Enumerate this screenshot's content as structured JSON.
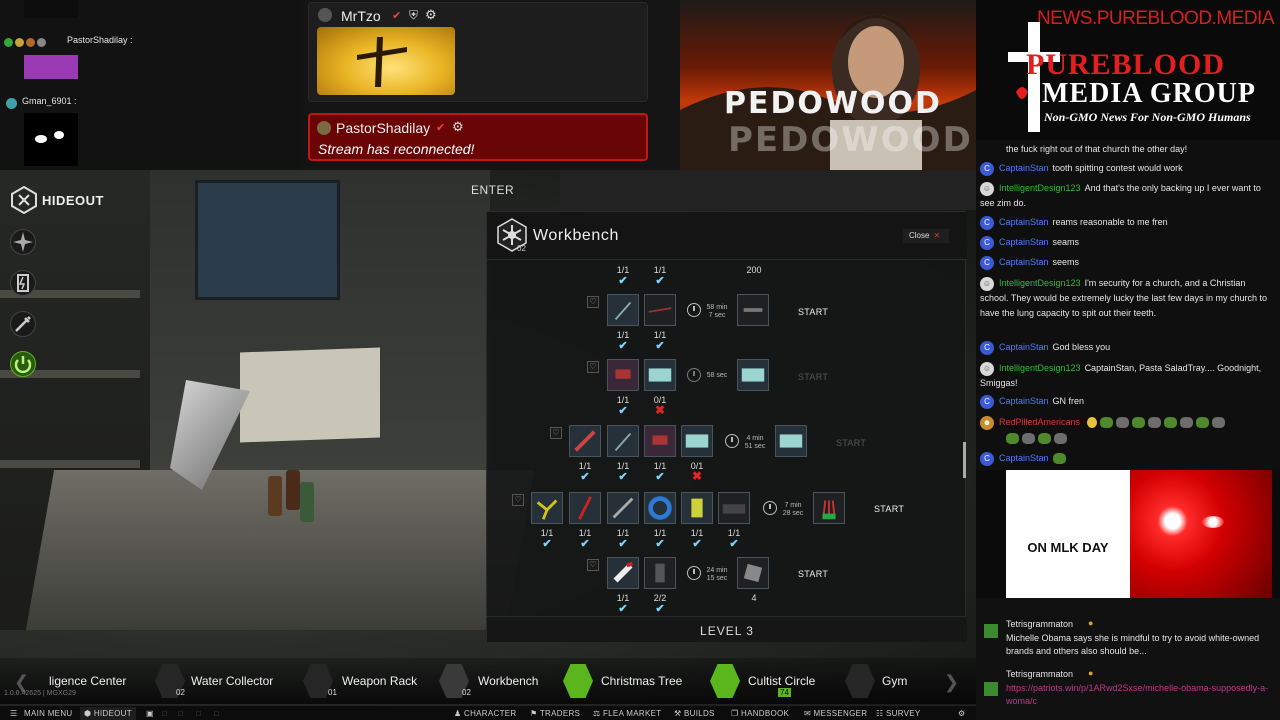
{
  "top_left_chat": {
    "user1": "PastorShadilay :",
    "user2": "Gman_6901 :"
  },
  "top_center_chat": {
    "mrtzo_name": "MrTzo",
    "reconnect_user": "PastorShadilay",
    "reconnect_message": "Stream has reconnected!"
  },
  "video": {
    "overlay_text": "PEDOWOOD"
  },
  "branding": {
    "url": "NEWS.PUREBLOOD.MEDIA",
    "line1": "PUREBLOOD",
    "line2": "MEDIA GROUP",
    "tagline": "Non-GMO News For Non-GMO Humans"
  },
  "chat": [
    {
      "user": "",
      "text": "the fuck right out of that church the other day!"
    },
    {
      "user": "CaptainStan",
      "text": "tooth spitting contest would work"
    },
    {
      "user": "IntelligentDesign123",
      "text": "And that's the only backing up I ever want to see zim do."
    },
    {
      "user": "CaptainStan",
      "text": "reams reasonable to me fren"
    },
    {
      "user": "CaptainStan",
      "text": "seams"
    },
    {
      "user": "CaptainStan",
      "text": "seems"
    },
    {
      "user": "IntelligentDesign123",
      "text": "I'm security for a church, and a Christian school. They would be extremely lucky the last few days in my church to have the lung capacity to spit out their teeth."
    },
    {
      "user": "CaptainStan",
      "text": "God bless you"
    },
    {
      "user": "IntelligentDesign123",
      "text": "CaptainStan, Pasta SaladTray.... Goodnight, Smiggas!"
    },
    {
      "user": "CaptainStan",
      "text": "GN fren"
    },
    {
      "user": "RedPilledAmericans",
      "text": ""
    },
    {
      "user": "CaptainStan",
      "text": ""
    }
  ],
  "mlk_panel": {
    "text": "ON MLK DAY"
  },
  "lower_chat": [
    {
      "user": "Tetrisgrammaton",
      "text": "Michelle Obama says she is mindful to try to avoid white-owned brands and others also should be..."
    },
    {
      "user": "Tetrisgrammaton",
      "text": "https://patriots.win/p/1ARwd2Sxse/michelle-obama-supposedly-a-woma/c"
    }
  ],
  "hud": {
    "hideout_title": "HIDEOUT",
    "enter_label": "ENTER"
  },
  "workbench": {
    "title": "Workbench",
    "level_badge": "02",
    "close_label": "Close",
    "footer": "LEVEL 3",
    "top_row": {
      "qty": [
        "1/1",
        "1/1"
      ],
      "output_qty": "200"
    },
    "rows": [
      {
        "qty": [
          "1/1",
          "1/1"
        ],
        "status": [
          "ok",
          "ok"
        ],
        "time": [
          "58 min",
          "7 sec"
        ],
        "start": "START",
        "active": true
      },
      {
        "qty": [
          "1/1",
          "0/1"
        ],
        "status": [
          "ok",
          "missing"
        ],
        "time": [
          "",
          "58 sec"
        ],
        "start": "START",
        "active": false
      },
      {
        "qty": [
          "1/1",
          "1/1",
          "1/1",
          "0/1"
        ],
        "status": [
          "ok",
          "ok",
          "ok",
          "missing"
        ],
        "time": [
          "4 min",
          "51 sec"
        ],
        "start": "START",
        "active": false
      },
      {
        "qty": [
          "1/1",
          "1/1",
          "1/1",
          "1/1",
          "1/1",
          "1/1"
        ],
        "status": [
          "ok",
          "ok",
          "ok",
          "ok",
          "ok",
          "ok"
        ],
        "time": [
          "7 min",
          "28 sec"
        ],
        "start": "START",
        "active": true
      },
      {
        "qty": [
          "1/1",
          "2/2"
        ],
        "status": [
          "ok",
          "ok"
        ],
        "time": [
          "24 min",
          "15 sec"
        ],
        "start": "START",
        "output_qty": "4",
        "active": true
      }
    ]
  },
  "zones": [
    {
      "label": "ligence Center",
      "level": ""
    },
    {
      "label": "Water Collector",
      "level": "02"
    },
    {
      "label": "Weapon Rack",
      "level": "01"
    },
    {
      "label": "Workbench",
      "level": "02"
    },
    {
      "label": "Christmas Tree",
      "level": ""
    },
    {
      "label": "Cultist Circle",
      "level": "74"
    },
    {
      "label": "Gym",
      "level": ""
    }
  ],
  "version": "1.0.0.42625 | MGXG29",
  "taskbar": {
    "main_menu": "MAIN MENU",
    "hideout": "HIDEOUT",
    "character": "CHARACTER",
    "traders": "TRADERS",
    "flea_market": "FLEA MARKET",
    "builds": "BUILDS",
    "handbook": "HANDBOOK",
    "messenger": "MESSENGER",
    "survey": "SURVEY"
  },
  "colors": {
    "accent_blue": "#7fd4ff",
    "missing_red": "#e12424",
    "chat_blue": "#4f7dff",
    "brand_red": "#e11f1f"
  }
}
